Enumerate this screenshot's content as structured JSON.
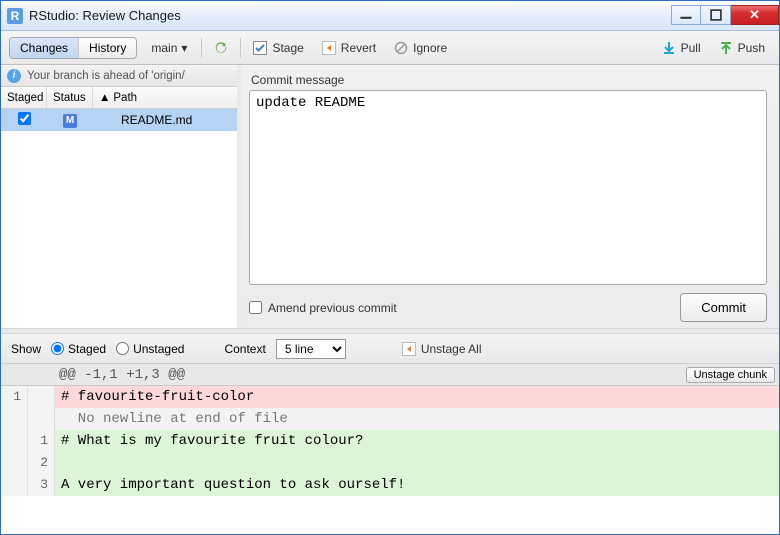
{
  "window": {
    "title": "RStudio: Review Changes"
  },
  "toolbar": {
    "changes": "Changes",
    "history": "History",
    "branch": "main",
    "stage": "Stage",
    "revert": "Revert",
    "ignore": "Ignore",
    "pull": "Pull",
    "push": "Push"
  },
  "info": {
    "message": "Your branch is ahead of 'origin/"
  },
  "fileheader": {
    "staged": "Staged",
    "status": "Status",
    "path": "Path"
  },
  "files": [
    {
      "staged": true,
      "status": "M",
      "name": "README.md"
    }
  ],
  "commit": {
    "label": "Commit message",
    "message": "update README",
    "amend_label": "Amend previous commit",
    "button": "Commit"
  },
  "diffctrl": {
    "show": "Show",
    "staged": "Staged",
    "unstaged": "Unstaged",
    "context": "Context",
    "context_value": "5 line",
    "unstage_all": "Unstage All"
  },
  "diff": {
    "hunk": "@@ -1,1 +1,3 @@",
    "unstage_chunk": "Unstage chunk",
    "lines": [
      {
        "a": "1",
        "b": "",
        "type": "del",
        "text": "# favourite-fruit-color"
      },
      {
        "a": "",
        "b": "",
        "type": "nonl",
        "text": "  No newline at end of file"
      },
      {
        "a": "",
        "b": "1",
        "type": "add",
        "text": "# What is my favourite fruit colour?"
      },
      {
        "a": "",
        "b": "2",
        "type": "add",
        "text": ""
      },
      {
        "a": "",
        "b": "3",
        "type": "add",
        "text": "A very important question to ask ourself!"
      }
    ]
  }
}
